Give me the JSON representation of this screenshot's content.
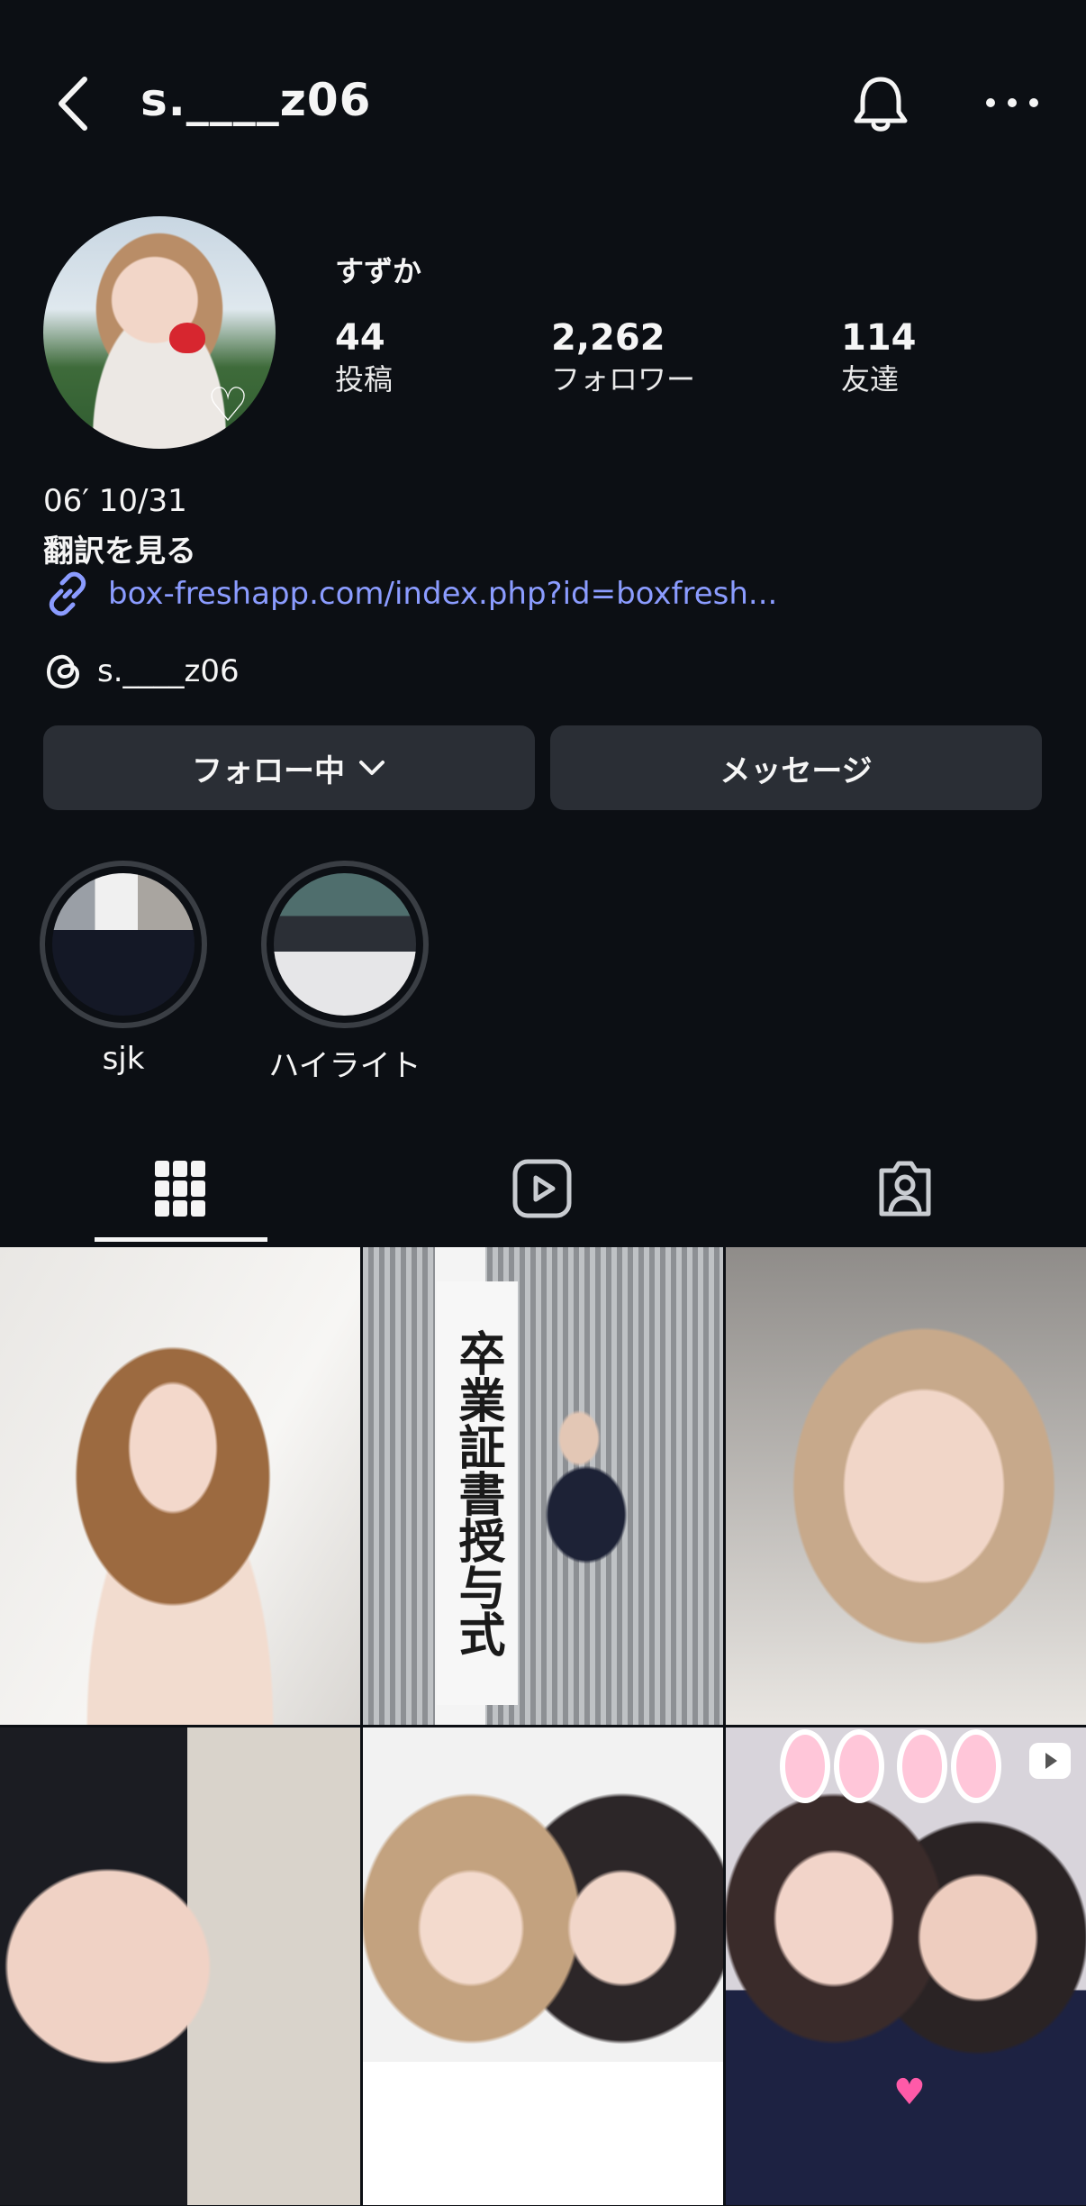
{
  "header": {
    "username": "s.____z06"
  },
  "profile": {
    "display_name": "すずか",
    "stats": {
      "posts": {
        "value": "44",
        "label": "投稿"
      },
      "followers": {
        "value": "2,262",
        "label": "フォロワー"
      },
      "friends": {
        "value": "114",
        "label": "友達"
      }
    },
    "bio": "06′ 10/31",
    "translate": "翻訳を見る",
    "link": "box-freshapp.com/index.php?id=boxfresh...",
    "threads_handle": "s.____z06",
    "link_color": "#8b9cff"
  },
  "actions": {
    "following_label": "フォロー中",
    "message_label": "メッセージ"
  },
  "highlights": [
    {
      "label": "sjk"
    },
    {
      "label": "ハイライト"
    }
  ],
  "tabs": [
    {
      "icon": "grid-icon",
      "active": true
    },
    {
      "icon": "reels-icon",
      "active": false
    },
    {
      "icon": "tagged-icon",
      "active": false
    }
  ],
  "grid": {
    "post2_sign_text": "卒業証書授与式"
  },
  "colors": {
    "background": "#0c0f14",
    "button": "#2a2e35",
    "text": "#f5f5f5"
  }
}
